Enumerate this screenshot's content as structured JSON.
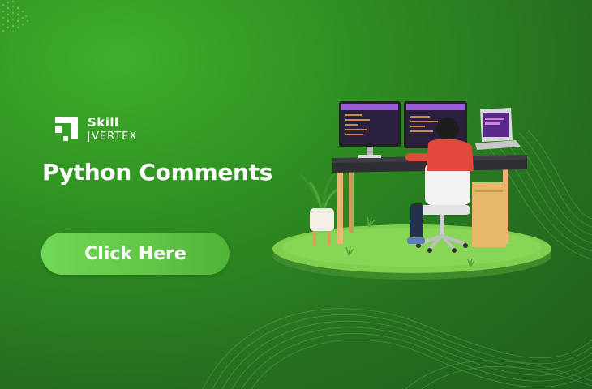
{
  "brand": {
    "line1": "Skill",
    "line2": "VERTEX"
  },
  "heading": "Python Comments",
  "cta_label": "Click Here",
  "colors": {
    "background": "#2e8f21",
    "button": "#66cf4d",
    "text": "#ffffff"
  },
  "icons": [
    "skill-vertex-logo-icon",
    "developer-desk-illustration"
  ]
}
